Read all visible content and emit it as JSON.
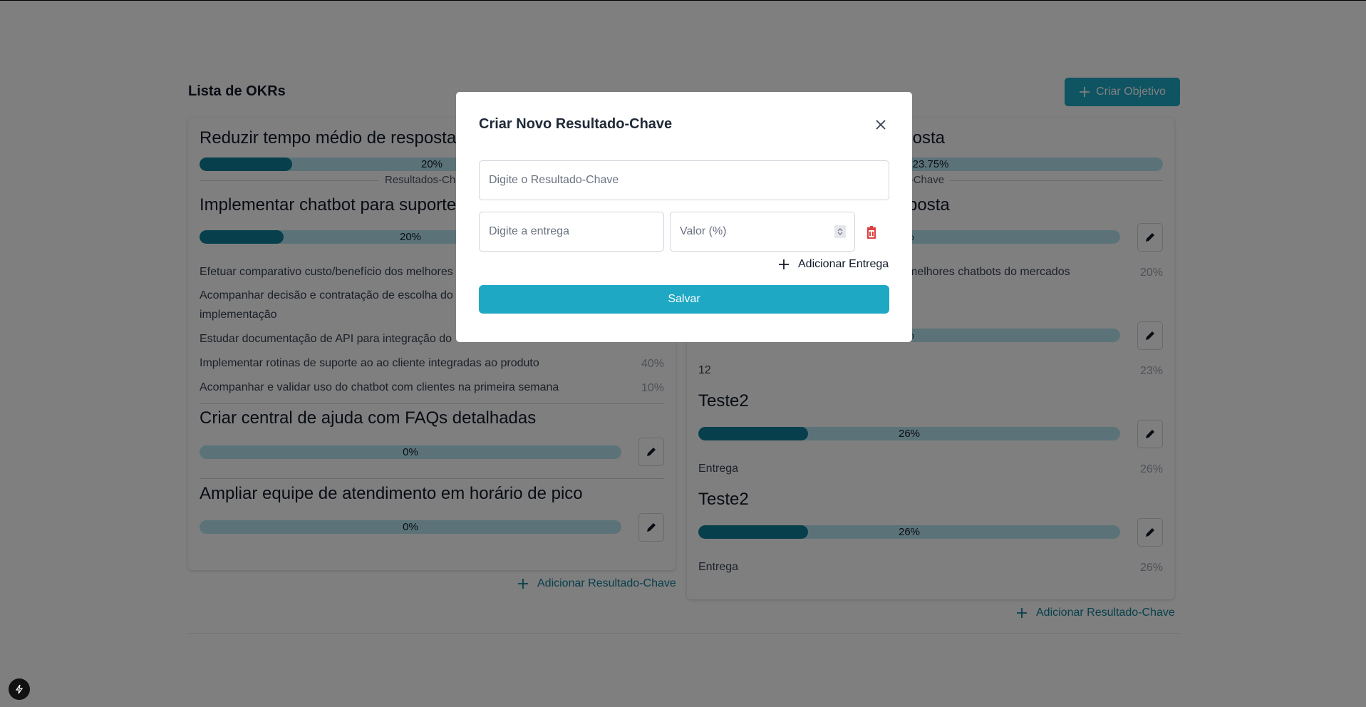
{
  "page": {
    "title": "Lista de OKRs",
    "create_button": "Criar Objetivo"
  },
  "left_card": {
    "objective": {
      "title": "Reduzir tempo médio de resposta",
      "progress": 0.2,
      "progress_label": "20%"
    },
    "section_label": "Resultados-Chave",
    "key_results": [
      {
        "title": "Implementar chatbot para suporte",
        "progress": 0.2,
        "progress_label": "20%",
        "deliveries": [
          {
            "text": "Efetuar comparativo custo/benefício dos melhores",
            "value": ""
          },
          {
            "text": "Acompanhar decisão e contratação de escolha do",
            "text2": "implementação",
            "value": ""
          },
          {
            "text": "Estudar documentação de API para integração do",
            "value": ""
          },
          {
            "text": "Implementar rotinas de suporte ao ao cliente integradas ao produto",
            "value": "40%"
          },
          {
            "text": "Acompanhar e validar uso do chatbot com clientes na primeira semana",
            "value": "10%"
          }
        ]
      },
      {
        "title": "Criar central de ajuda com FAQs detalhadas",
        "progress": 0,
        "progress_label": "0%"
      },
      {
        "title": "Ampliar equipe de atendimento em horário de pico",
        "progress": 0,
        "progress_label": "0%"
      }
    ],
    "add_kr_label": "Adicionar Resultado-Chave"
  },
  "right_card": {
    "objective": {
      "title": "posta",
      "progress": 0.2375,
      "progress_label": "23.75%"
    },
    "section_label": "tados-Chave",
    "key_results": [
      {
        "title": "posta",
        "progress": 0.2,
        "progress_label": "%",
        "deliveries": [
          {
            "text": "melhores chatbots do mercados",
            "value": "20%"
          }
        ]
      },
      {
        "title": "",
        "progress": 0.23,
        "progress_label": "%",
        "deliveries": [
          {
            "text": "12",
            "value": "23%"
          }
        ]
      },
      {
        "title": "Teste2",
        "progress": 0.26,
        "progress_label": "26%",
        "deliveries": [
          {
            "text": "Entrega",
            "value": "26%"
          }
        ]
      },
      {
        "title": "Teste2",
        "progress": 0.26,
        "progress_label": "26%",
        "deliveries": [
          {
            "text": "Entrega",
            "value": "26%"
          }
        ]
      }
    ],
    "add_kr_label": "Adicionar Resultado-Chave"
  },
  "modal": {
    "title": "Criar Novo Resultado-Chave",
    "kr_placeholder": "Digite o Resultado-Chave",
    "entrega_placeholder": "Digite a entrega",
    "valor_placeholder": "Valor (%)",
    "add_entrega_label": "Adicionar Entrega",
    "save_label": "Salvar"
  },
  "colors": {
    "accent": "#1ea8c4",
    "bar_fill": "#0e7f98",
    "bar_track": "#b6e7f0",
    "danger": "#dc2626"
  }
}
